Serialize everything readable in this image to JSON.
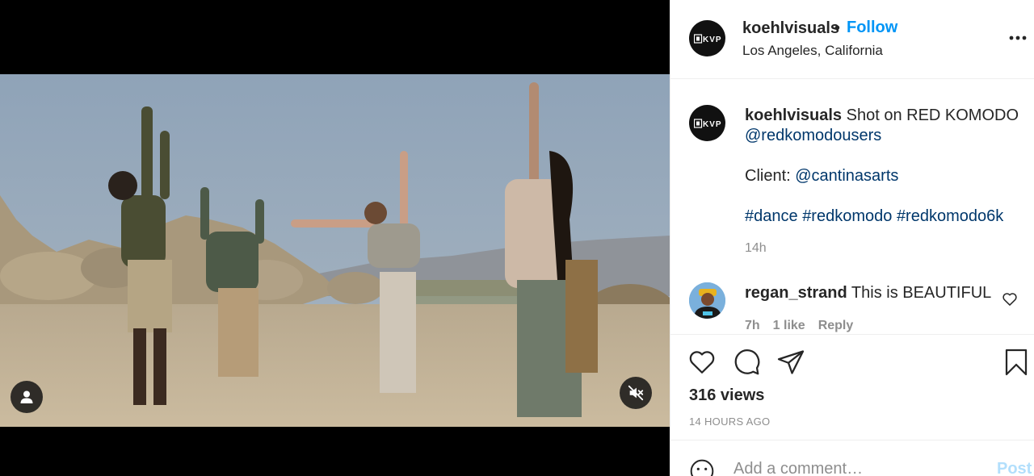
{
  "post": {
    "username": "koehlvisuals",
    "separator": "•",
    "follow_label": "Follow",
    "location": "Los Angeles, California",
    "avatar_text": "KVP",
    "more_icon": "more-horizontal-icon"
  },
  "caption": {
    "username": "koehlvisuals",
    "line1_text": " Shot on RED KOMODO",
    "mention1": "@redkomodousers",
    "client_label": "Client: ",
    "client_mention": "@cantinasarts",
    "hashtags": [
      "#dance",
      "#redkomodo",
      "#redkomodo6k"
    ],
    "time": "14h"
  },
  "comments": [
    {
      "username": "regan_strand",
      "text": " This is BEAUTIFUL",
      "time": "7h",
      "likes": "1 like",
      "reply_label": "Reply"
    }
  ],
  "media": {
    "tag_icon": "user-tag-icon",
    "mute_icon": "muted-speaker-icon"
  },
  "actions": {
    "views": "316 views",
    "posted_ago": "14 HOURS AGO",
    "comment_placeholder": "Add a comment…",
    "post_label": "Post"
  },
  "colors": {
    "link": "#00376b",
    "follow": "#0095f6",
    "muted": "#8e8e8e",
    "post_disabled": "#b2dffc"
  }
}
